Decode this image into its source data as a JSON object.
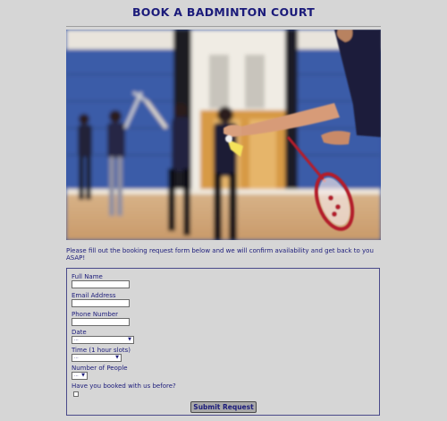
{
  "page": {
    "title": "BOOK A BADMINTON COURT",
    "intro": "Please fill out the booking request form below and we will confirm availability and get back to you ASAP!"
  },
  "photo": {
    "alt": "badminton players on court"
  },
  "form": {
    "full_name": {
      "label": "Full Name",
      "value": ""
    },
    "email": {
      "label": "Email Address",
      "value": ""
    },
    "phone": {
      "label": "Phone Number",
      "value": ""
    },
    "date": {
      "label": "Date",
      "selected": "..."
    },
    "time": {
      "label": "Time (1 hour slots)",
      "selected": "..."
    },
    "people": {
      "label": "Number of People",
      "selected": "..."
    },
    "booked_before": {
      "label": "Have you booked with us before?",
      "checked": false
    },
    "submit_label": "Submit Request"
  },
  "colors": {
    "background": "#d6d6d6",
    "text": "#1b1b7a"
  }
}
